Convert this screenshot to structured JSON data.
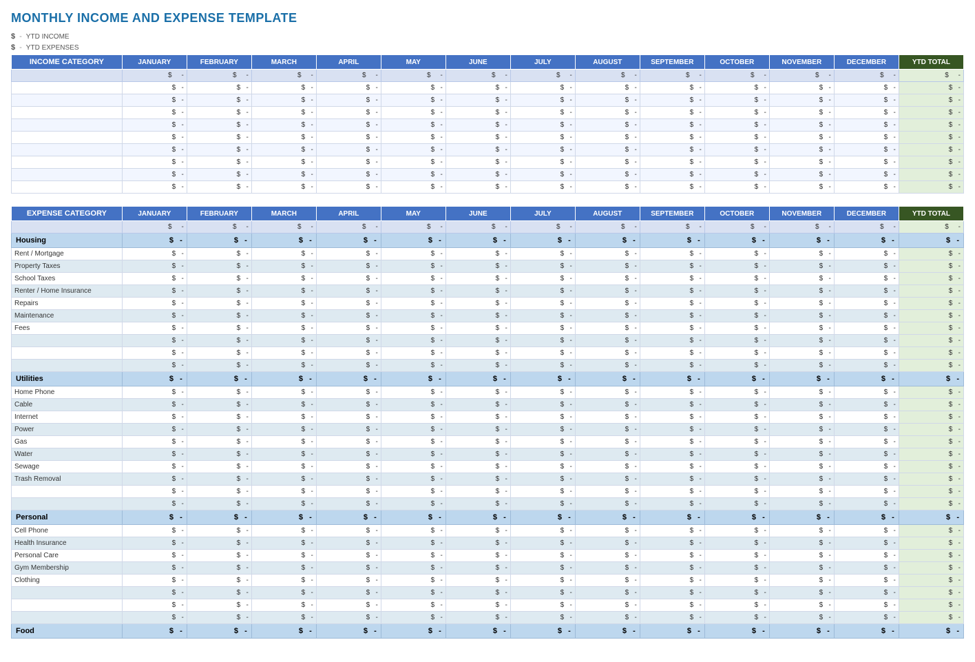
{
  "title": "MONTHLY INCOME AND EXPENSE TEMPLATE",
  "ytd_income_label": "YTD INCOME",
  "ytd_expenses_label": "YTD EXPENSES",
  "dollar_sign": "$",
  "dash": "-",
  "months": [
    "JANUARY",
    "FEBRUARY",
    "MARCH",
    "APRIL",
    "MAY",
    "JUNE",
    "JULY",
    "AUGUST",
    "SEPTEMBER",
    "OCTOBER",
    "NOVEMBER",
    "DECEMBER"
  ],
  "ytd_total_label": "YTD TOTAL",
  "income_category_label": "INCOME CATEGORY",
  "expense_category_label": "EXPENSE CATEGORY",
  "income_rows": [
    {
      "category": "",
      "values": [
        "-",
        "-",
        "-",
        "-",
        "-",
        "-",
        "-",
        "-",
        "-",
        "-",
        "-",
        "-"
      ],
      "ytd": "-"
    },
    {
      "category": "",
      "values": [
        "-",
        "-",
        "-",
        "-",
        "-",
        "-",
        "-",
        "-",
        "-",
        "-",
        "-",
        "-"
      ],
      "ytd": "-"
    },
    {
      "category": "",
      "values": [
        "-",
        "-",
        "-",
        "-",
        "-",
        "-",
        "-",
        "-",
        "-",
        "-",
        "-",
        "-"
      ],
      "ytd": "-"
    },
    {
      "category": "",
      "values": [
        "-",
        "-",
        "-",
        "-",
        "-",
        "-",
        "-",
        "-",
        "-",
        "-",
        "-",
        "-"
      ],
      "ytd": "-"
    },
    {
      "category": "",
      "values": [
        "-",
        "-",
        "-",
        "-",
        "-",
        "-",
        "-",
        "-",
        "-",
        "-",
        "-",
        "-"
      ],
      "ytd": "-"
    },
    {
      "category": "",
      "values": [
        "-",
        "-",
        "-",
        "-",
        "-",
        "-",
        "-",
        "-",
        "-",
        "-",
        "-",
        "-"
      ],
      "ytd": "-"
    },
    {
      "category": "",
      "values": [
        "-",
        "-",
        "-",
        "-",
        "-",
        "-",
        "-",
        "-",
        "-",
        "-",
        "-",
        "-"
      ],
      "ytd": "-"
    },
    {
      "category": "",
      "values": [
        "-",
        "-",
        "-",
        "-",
        "-",
        "-",
        "-",
        "-",
        "-",
        "-",
        "-",
        "-"
      ],
      "ytd": "-"
    },
    {
      "category": "",
      "values": [
        "-",
        "-",
        "-",
        "-",
        "-",
        "-",
        "-",
        "-",
        "-",
        "-",
        "-",
        "-"
      ],
      "ytd": "-"
    }
  ],
  "expense_sections": [
    {
      "name": "Housing",
      "subtotal": {
        "values": [
          "-",
          "-",
          "-",
          "-",
          "-",
          "-",
          "-",
          "-",
          "-",
          "-",
          "-",
          "-"
        ],
        "ytd": "-"
      },
      "rows": [
        {
          "category": "Rent / Mortgage",
          "values": [
            "-",
            "-",
            "-",
            "-",
            "-",
            "-",
            "-",
            "-",
            "-",
            "-",
            "-",
            "-"
          ],
          "ytd": "-"
        },
        {
          "category": "Property Taxes",
          "values": [
            "-",
            "-",
            "-",
            "-",
            "-",
            "-",
            "-",
            "-",
            "-",
            "-",
            "-",
            "-"
          ],
          "ytd": "-"
        },
        {
          "category": "School Taxes",
          "values": [
            "-",
            "-",
            "-",
            "-",
            "-",
            "-",
            "-",
            "-",
            "-",
            "-",
            "-",
            "-"
          ],
          "ytd": "-"
        },
        {
          "category": "Renter / Home Insurance",
          "values": [
            "-",
            "-",
            "-",
            "-",
            "-",
            "-",
            "-",
            "-",
            "-",
            "-",
            "-",
            "-"
          ],
          "ytd": "-"
        },
        {
          "category": "Repairs",
          "values": [
            "-",
            "-",
            "-",
            "-",
            "-",
            "-",
            "-",
            "-",
            "-",
            "-",
            "-",
            "-"
          ],
          "ytd": "-"
        },
        {
          "category": "Maintenance",
          "values": [
            "-",
            "-",
            "-",
            "-",
            "-",
            "-",
            "-",
            "-",
            "-",
            "-",
            "-",
            "-"
          ],
          "ytd": "-"
        },
        {
          "category": "Fees",
          "values": [
            "-",
            "-",
            "-",
            "-",
            "-",
            "-",
            "-",
            "-",
            "-",
            "-",
            "-",
            "-"
          ],
          "ytd": "-"
        },
        {
          "category": "",
          "values": [
            "-",
            "-",
            "-",
            "-",
            "-",
            "-",
            "-",
            "-",
            "-",
            "-",
            "-",
            "-"
          ],
          "ytd": "-"
        },
        {
          "category": "",
          "values": [
            "-",
            "-",
            "-",
            "-",
            "-",
            "-",
            "-",
            "-",
            "-",
            "-",
            "-",
            "-"
          ],
          "ytd": "-"
        },
        {
          "category": "",
          "values": [
            "-",
            "-",
            "-",
            "-",
            "-",
            "-",
            "-",
            "-",
            "-",
            "-",
            "-",
            "-"
          ],
          "ytd": "-"
        }
      ]
    },
    {
      "name": "Utilities",
      "subtotal": {
        "values": [
          "-",
          "-",
          "-",
          "-",
          "-",
          "-",
          "-",
          "-",
          "-",
          "-",
          "-",
          "-"
        ],
        "ytd": "-"
      },
      "rows": [
        {
          "category": "Home Phone",
          "values": [
            "-",
            "-",
            "-",
            "-",
            "-",
            "-",
            "-",
            "-",
            "-",
            "-",
            "-",
            "-"
          ],
          "ytd": "-"
        },
        {
          "category": "Cable",
          "values": [
            "-",
            "-",
            "-",
            "-",
            "-",
            "-",
            "-",
            "-",
            "-",
            "-",
            "-",
            "-"
          ],
          "ytd": "-"
        },
        {
          "category": "Internet",
          "values": [
            "-",
            "-",
            "-",
            "-",
            "-",
            "-",
            "-",
            "-",
            "-",
            "-",
            "-",
            "-"
          ],
          "ytd": "-"
        },
        {
          "category": "Power",
          "values": [
            "-",
            "-",
            "-",
            "-",
            "-",
            "-",
            "-",
            "-",
            "-",
            "-",
            "-",
            "-"
          ],
          "ytd": "-"
        },
        {
          "category": "Gas",
          "values": [
            "-",
            "-",
            "-",
            "-",
            "-",
            "-",
            "-",
            "-",
            "-",
            "-",
            "-",
            "-"
          ],
          "ytd": "-"
        },
        {
          "category": "Water",
          "values": [
            "-",
            "-",
            "-",
            "-",
            "-",
            "-",
            "-",
            "-",
            "-",
            "-",
            "-",
            "-"
          ],
          "ytd": "-"
        },
        {
          "category": "Sewage",
          "values": [
            "-",
            "-",
            "-",
            "-",
            "-",
            "-",
            "-",
            "-",
            "-",
            "-",
            "-",
            "-"
          ],
          "ytd": "-"
        },
        {
          "category": "Trash Removal",
          "values": [
            "-",
            "-",
            "-",
            "-",
            "-",
            "-",
            "-",
            "-",
            "-",
            "-",
            "-",
            "-"
          ],
          "ytd": "-"
        },
        {
          "category": "",
          "values": [
            "-",
            "-",
            "-",
            "-",
            "-",
            "-",
            "-",
            "-",
            "-",
            "-",
            "-",
            "-"
          ],
          "ytd": "-"
        },
        {
          "category": "",
          "values": [
            "-",
            "-",
            "-",
            "-",
            "-",
            "-",
            "-",
            "-",
            "-",
            "-",
            "-",
            "-"
          ],
          "ytd": "-"
        }
      ]
    },
    {
      "name": "Personal",
      "subtotal": {
        "values": [
          "-",
          "-",
          "-",
          "-",
          "-",
          "-",
          "-",
          "-",
          "-",
          "-",
          "-",
          "-"
        ],
        "ytd": "-"
      },
      "rows": [
        {
          "category": "Cell Phone",
          "values": [
            "-",
            "-",
            "-",
            "-",
            "-",
            "-",
            "-",
            "-",
            "-",
            "-",
            "-",
            "-"
          ],
          "ytd": "-"
        },
        {
          "category": "Health Insurance",
          "values": [
            "-",
            "-",
            "-",
            "-",
            "-",
            "-",
            "-",
            "-",
            "-",
            "-",
            "-",
            "-"
          ],
          "ytd": "-"
        },
        {
          "category": "Personal Care",
          "values": [
            "-",
            "-",
            "-",
            "-",
            "-",
            "-",
            "-",
            "-",
            "-",
            "-",
            "-",
            "-"
          ],
          "ytd": "-"
        },
        {
          "category": "Gym Membership",
          "values": [
            "-",
            "-",
            "-",
            "-",
            "-",
            "-",
            "-",
            "-",
            "-",
            "-",
            "-",
            "-"
          ],
          "ytd": "-"
        },
        {
          "category": "Clothing",
          "values": [
            "-",
            "-",
            "-",
            "-",
            "-",
            "-",
            "-",
            "-",
            "-",
            "-",
            "-",
            "-"
          ],
          "ytd": "-"
        },
        {
          "category": "",
          "values": [
            "-",
            "-",
            "-",
            "-",
            "-",
            "-",
            "-",
            "-",
            "-",
            "-",
            "-",
            "-"
          ],
          "ytd": "-"
        },
        {
          "category": "",
          "values": [
            "-",
            "-",
            "-",
            "-",
            "-",
            "-",
            "-",
            "-",
            "-",
            "-",
            "-",
            "-"
          ],
          "ytd": "-"
        },
        {
          "category": "",
          "values": [
            "-",
            "-",
            "-",
            "-",
            "-",
            "-",
            "-",
            "-",
            "-",
            "-",
            "-",
            "-"
          ],
          "ytd": "-"
        }
      ]
    },
    {
      "name": "Food",
      "subtotal": {
        "values": [
          "-",
          "-",
          "-",
          "-",
          "-",
          "-",
          "-",
          "-",
          "-",
          "-",
          "-",
          "-"
        ],
        "ytd": "-"
      },
      "rows": []
    }
  ]
}
